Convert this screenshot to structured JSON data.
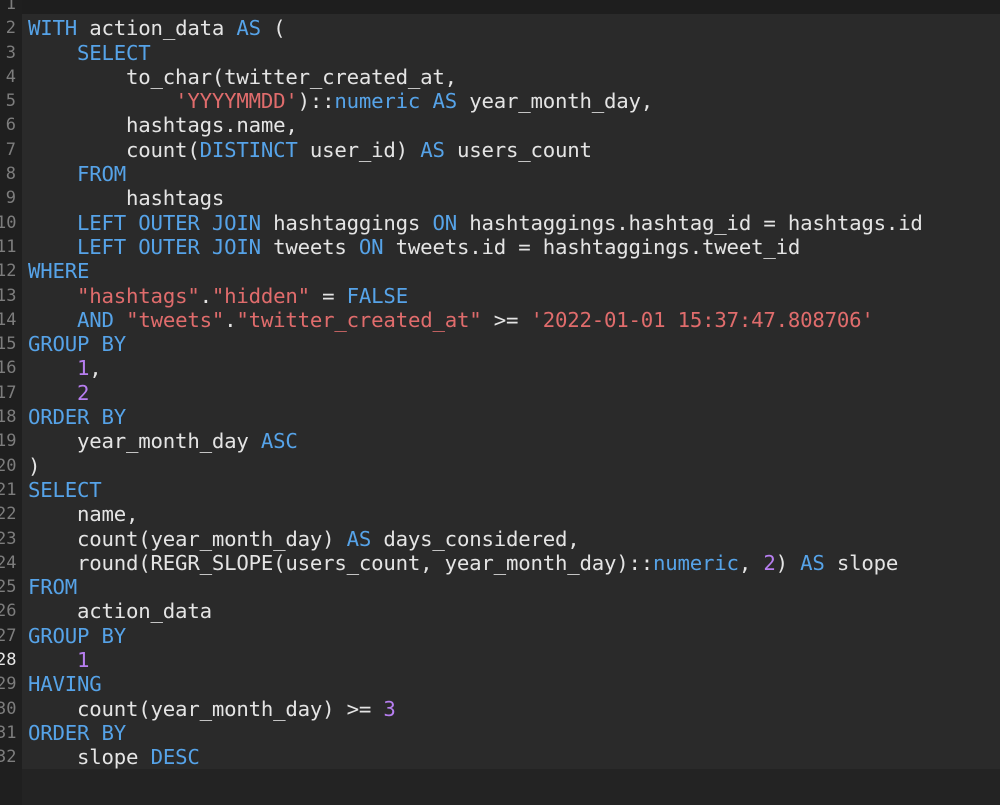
{
  "editor": {
    "colors": {
      "keyword": "#56a3e8",
      "string": "#e06c6c",
      "number": "#b77ef0",
      "plain": "#e4e4e4",
      "line_number": "#7d7d7d",
      "background": "#2a2a2a"
    },
    "active_line": "28",
    "lines": [
      {
        "n": "1",
        "t": []
      },
      {
        "n": "2",
        "t": [
          [
            "kw",
            "WITH"
          ],
          [
            "p",
            " action_data "
          ],
          [
            "kw",
            "AS"
          ],
          [
            "p",
            " ("
          ]
        ]
      },
      {
        "n": "3",
        "t": [
          [
            "p",
            "    "
          ],
          [
            "kw",
            "SELECT"
          ]
        ]
      },
      {
        "n": "4",
        "t": [
          [
            "p",
            "        to_char(twitter_created_at,"
          ]
        ]
      },
      {
        "n": "5",
        "t": [
          [
            "p",
            "            "
          ],
          [
            "str",
            "'YYYYMMDD'"
          ],
          [
            "p",
            "):"
          ],
          [
            "p",
            ":"
          ],
          [
            "kw",
            "numeric"
          ],
          [
            "p",
            " "
          ],
          [
            "kw",
            "AS"
          ],
          [
            "p",
            " year_month_day,"
          ]
        ]
      },
      {
        "n": "6",
        "t": [
          [
            "p",
            "        hashtags.name,"
          ]
        ]
      },
      {
        "n": "7",
        "t": [
          [
            "p",
            "        count("
          ],
          [
            "kw",
            "DISTINCT"
          ],
          [
            "p",
            " user_id) "
          ],
          [
            "kw",
            "AS"
          ],
          [
            "p",
            " users_count"
          ]
        ]
      },
      {
        "n": "8",
        "t": [
          [
            "p",
            "    "
          ],
          [
            "kw",
            "FROM"
          ]
        ]
      },
      {
        "n": "9",
        "t": [
          [
            "p",
            "        hashtags"
          ]
        ]
      },
      {
        "n": "10",
        "t": [
          [
            "p",
            "    "
          ],
          [
            "kw",
            "LEFT OUTER JOIN"
          ],
          [
            "p",
            " hashtaggings "
          ],
          [
            "kw",
            "ON"
          ],
          [
            "p",
            " hashtaggings.hashtag_id = hashtags.id"
          ]
        ]
      },
      {
        "n": "11",
        "t": [
          [
            "p",
            "    "
          ],
          [
            "kw",
            "LEFT OUTER JOIN"
          ],
          [
            "p",
            " tweets "
          ],
          [
            "kw",
            "ON"
          ],
          [
            "p",
            " tweets.id = hashtaggings.tweet_id"
          ]
        ]
      },
      {
        "n": "12",
        "t": [
          [
            "kw",
            "WHERE"
          ]
        ]
      },
      {
        "n": "13",
        "t": [
          [
            "p",
            "    "
          ],
          [
            "str",
            "\"hashtags\""
          ],
          [
            "p",
            "."
          ],
          [
            "str",
            "\"hidden\""
          ],
          [
            "p",
            " = "
          ],
          [
            "kw",
            "FALSE"
          ]
        ]
      },
      {
        "n": "14",
        "t": [
          [
            "p",
            "    "
          ],
          [
            "kw",
            "AND"
          ],
          [
            "p",
            " "
          ],
          [
            "str",
            "\"tweets\""
          ],
          [
            "p",
            "."
          ],
          [
            "str",
            "\"twitter_created_at\""
          ],
          [
            "p",
            " >= "
          ],
          [
            "str",
            "'2022-01-01 15:37:47.808706'"
          ]
        ]
      },
      {
        "n": "15",
        "t": [
          [
            "kw",
            "GROUP BY"
          ]
        ]
      },
      {
        "n": "16",
        "t": [
          [
            "p",
            "    "
          ],
          [
            "num",
            "1"
          ],
          [
            "p",
            ","
          ]
        ]
      },
      {
        "n": "17",
        "t": [
          [
            "p",
            "    "
          ],
          [
            "num",
            "2"
          ]
        ]
      },
      {
        "n": "18",
        "t": [
          [
            "kw",
            "ORDER BY"
          ]
        ]
      },
      {
        "n": "19",
        "t": [
          [
            "p",
            "    year_month_day "
          ],
          [
            "kw",
            "ASC"
          ]
        ]
      },
      {
        "n": "20",
        "t": [
          [
            "p",
            ")"
          ]
        ]
      },
      {
        "n": "21",
        "t": [
          [
            "kw",
            "SELECT"
          ]
        ]
      },
      {
        "n": "22",
        "t": [
          [
            "p",
            "    name,"
          ]
        ]
      },
      {
        "n": "23",
        "t": [
          [
            "p",
            "    count(year_month_day) "
          ],
          [
            "kw",
            "AS"
          ],
          [
            "p",
            " days_considered,"
          ]
        ]
      },
      {
        "n": "24",
        "t": [
          [
            "p",
            "    round(REGR_SLOPE(users_count, year_month_day)::"
          ],
          [
            "kw",
            "numeric"
          ],
          [
            "p",
            ", "
          ],
          [
            "num",
            "2"
          ],
          [
            "p",
            ") "
          ],
          [
            "kw",
            "AS"
          ],
          [
            "p",
            " slope"
          ]
        ]
      },
      {
        "n": "25",
        "t": [
          [
            "kw",
            "FROM"
          ]
        ]
      },
      {
        "n": "26",
        "t": [
          [
            "p",
            "    action_data"
          ]
        ]
      },
      {
        "n": "27",
        "t": [
          [
            "kw",
            "GROUP BY"
          ]
        ]
      },
      {
        "n": "28",
        "t": [
          [
            "p",
            "    "
          ],
          [
            "num",
            "1"
          ]
        ]
      },
      {
        "n": "29",
        "t": [
          [
            "kw",
            "HAVING"
          ]
        ]
      },
      {
        "n": "30",
        "t": [
          [
            "p",
            "    count(year_month_day) >= "
          ],
          [
            "num",
            "3"
          ]
        ]
      },
      {
        "n": "31",
        "t": [
          [
            "kw",
            "ORDER BY"
          ]
        ]
      },
      {
        "n": "32",
        "t": [
          [
            "p",
            "    slope "
          ],
          [
            "kw",
            "DESC"
          ]
        ]
      }
    ]
  }
}
